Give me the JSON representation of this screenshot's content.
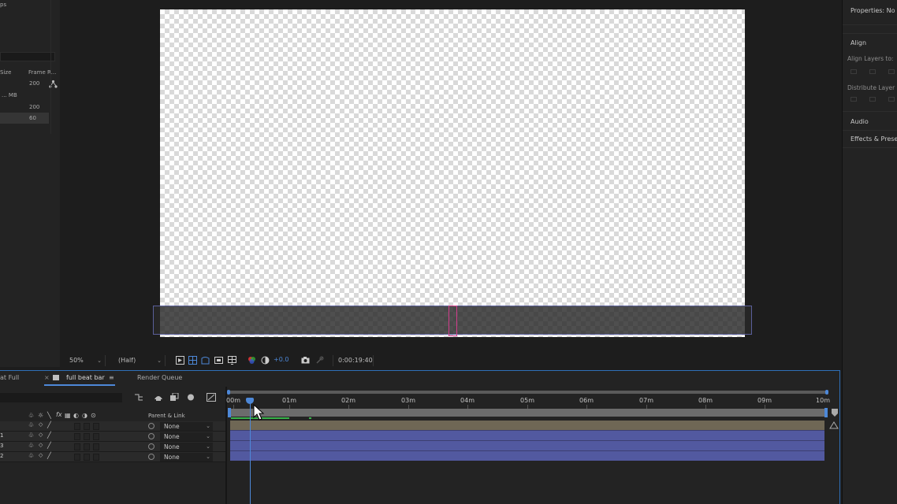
{
  "project_panel": {
    "title_fragment": "ps",
    "columns": [
      "Size",
      "Frame R..."
    ],
    "rows": [
      {
        "size": "",
        "frame_rate": "200"
      },
      {
        "size": "... MB",
        "frame_rate": ""
      },
      {
        "size": "",
        "frame_rate": "200"
      },
      {
        "size": "",
        "frame_rate": "60"
      }
    ]
  },
  "viewer": {
    "zoom": "50%",
    "resolution": "(Half)",
    "exposure": "+0.0",
    "timecode": "0:00:19:40"
  },
  "right_panel": {
    "properties": "Properties: No S",
    "align": "Align",
    "align_layers_to": "Align Layers to:",
    "distribute_layers": "Distribute Layer",
    "audio": "Audio",
    "effects_presets": "Effects & Preset"
  },
  "timeline": {
    "tabs": [
      "at Full",
      "full beat bar",
      "Render Queue"
    ],
    "parent_link_header": "Parent & Link",
    "ruler_ticks": [
      "00m",
      "01m",
      "02m",
      "03m",
      "04m",
      "05m",
      "06m",
      "07m",
      "08m",
      "09m",
      "10m"
    ],
    "layers": [
      {
        "num": "",
        "parent": "None"
      },
      {
        "num": "1",
        "parent": "None"
      },
      {
        "num": "3",
        "parent": "None"
      },
      {
        "num": "2",
        "parent": "None"
      }
    ],
    "colors": {
      "track_tan": "#6f6755",
      "track_blue": "#5259a0",
      "playhead": "#4d88d8",
      "work_area": "#6c6c6c"
    }
  }
}
